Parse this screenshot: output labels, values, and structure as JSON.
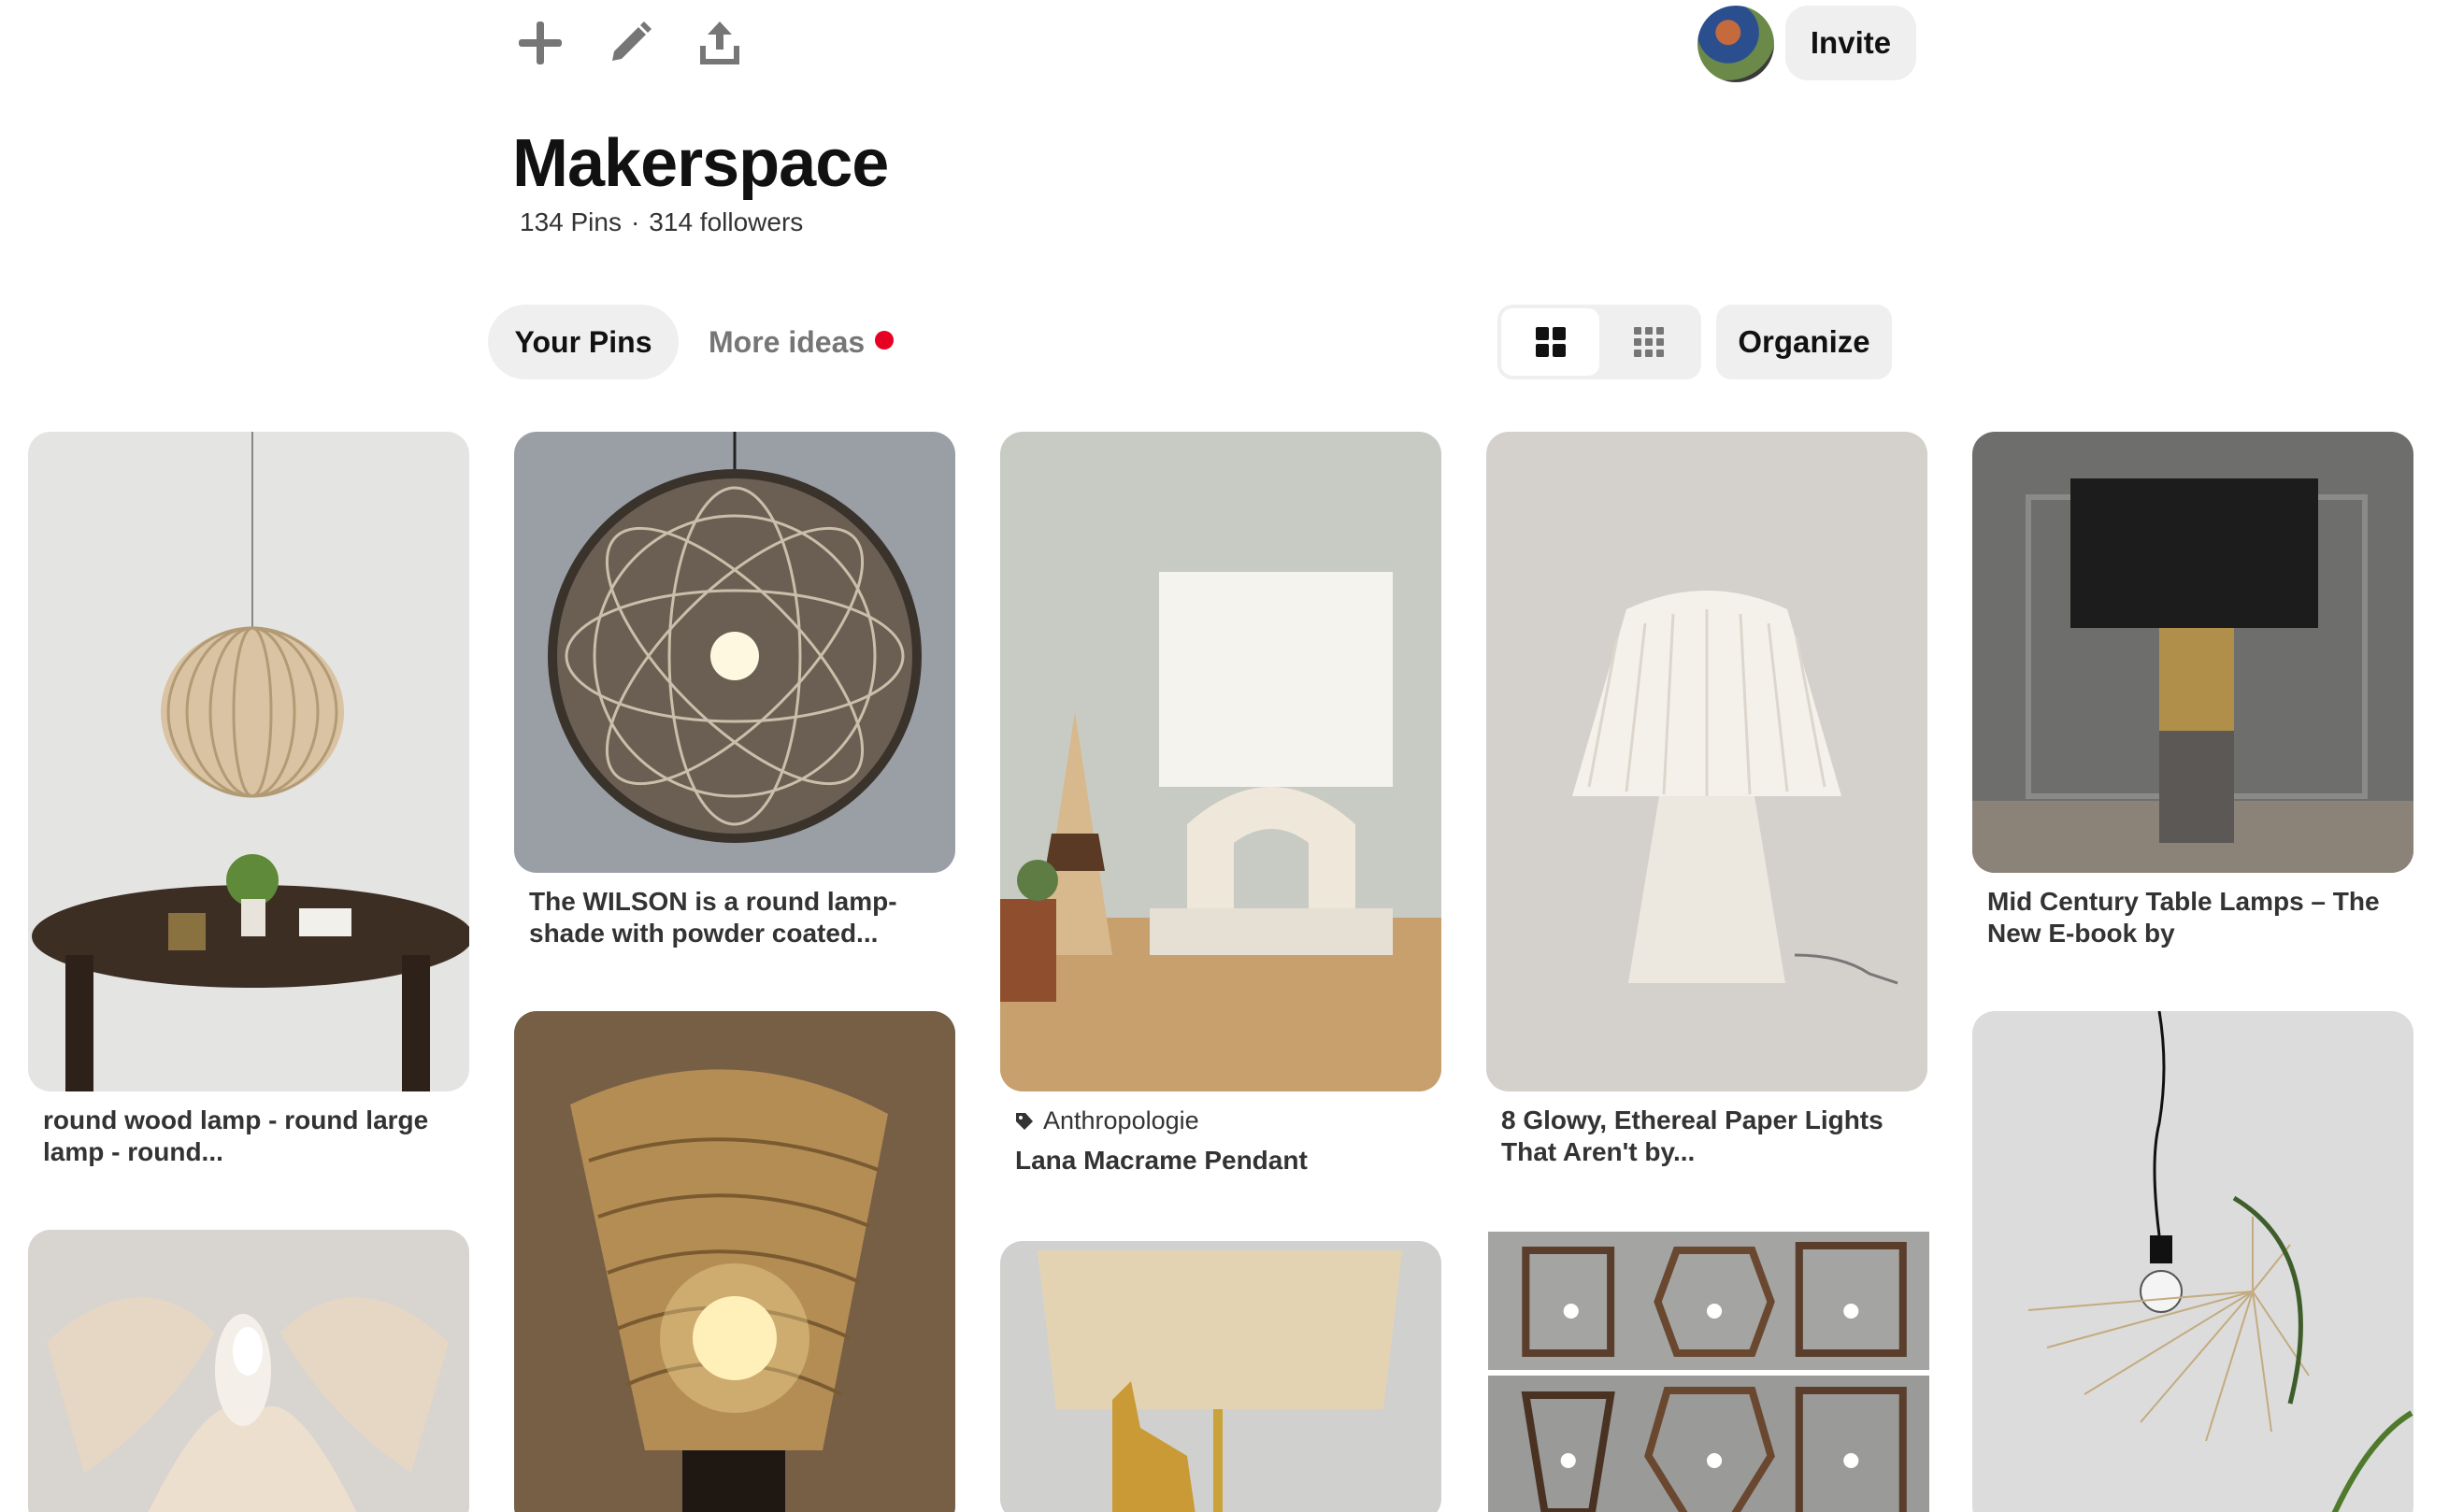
{
  "toolbar": {
    "icons": [
      "plus-icon",
      "pencil-icon",
      "upload-icon"
    ]
  },
  "header": {
    "invite_label": "Invite",
    "board_title": "Makerspace",
    "pins_count": "134 Pins",
    "separator": "·",
    "followers": "314 followers"
  },
  "tabs": {
    "your_pins": "Your Pins",
    "more_ideas": "More ideas"
  },
  "controls": {
    "organize_label": "Organize"
  },
  "pins": [
    {
      "title": "round wood lamp - round large lamp - round..."
    },
    {
      "title": "The WILSON is a round lamp-shade with powder coated..."
    },
    {
      "source": "Anthropologie",
      "title": "Lana Macrame Pendant"
    },
    {
      "title": "8 Glowy, Ethereal Paper Lights That Aren't by..."
    },
    {
      "title": "Mid Century Table Lamps – The New E-book by"
    }
  ],
  "colors": {
    "accent_red": "#e60023",
    "button_gray": "#efefef",
    "muted_text": "#767676"
  }
}
